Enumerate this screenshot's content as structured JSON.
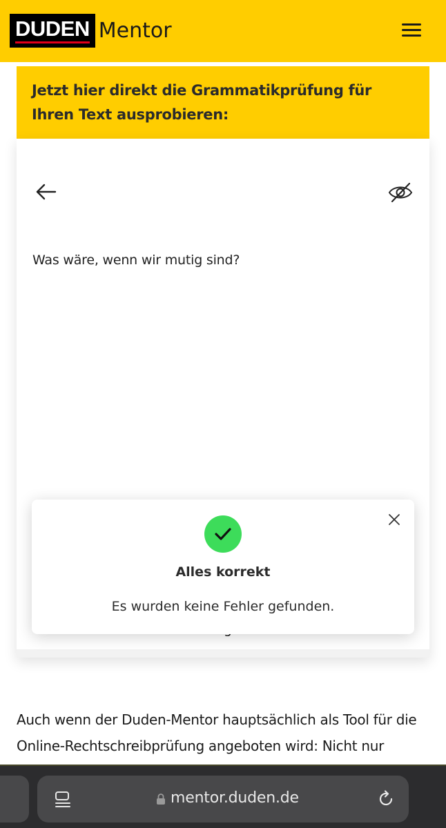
{
  "header": {
    "logo_word": "DUDEN",
    "logo_sub": "Mentor",
    "menu_icon": "hamburger-menu-icon",
    "background": "#ffcd00"
  },
  "banner": {
    "text": "Jetzt hier direkt die Grammatikprüfung für Ihren Text ausprobieren:"
  },
  "editor": {
    "back_icon": "arrow-left-icon",
    "visibility_icon": "eye-slash-icon",
    "text": "Was wäre, wenn wir mutig sind?",
    "partial_hidden_text": "g"
  },
  "toast": {
    "status_icon": "checkmark-icon",
    "title": "Alles korrekt",
    "message": "Es wurden keine Fehler gefunden.",
    "close_icon": "close-icon",
    "success_color": "#3ddc5a"
  },
  "article": {
    "text": "Auch wenn der Duden-Mentor hauptsächlich als Tool für die Online-Rechtschreibprüfung angeboten wird: Nicht nur"
  },
  "browser": {
    "url": "mentor.duden.de",
    "tabs_icon": "page-menu-icon",
    "lock_icon": "lock-icon",
    "reload_icon": "reload-icon"
  }
}
